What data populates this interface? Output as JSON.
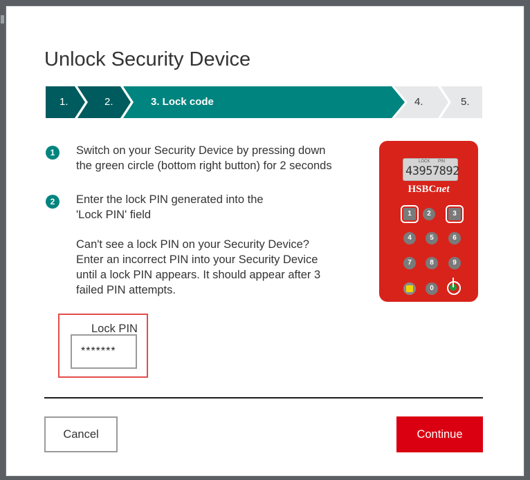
{
  "dialog": {
    "title": "Unlock Security Device"
  },
  "stepper": {
    "steps": [
      {
        "label": "1.",
        "state": "done"
      },
      {
        "label": "2.",
        "state": "done"
      },
      {
        "label": "3. Lock code",
        "state": "current"
      },
      {
        "label": "4.",
        "state": "todo"
      },
      {
        "label": "5.",
        "state": "todo"
      }
    ],
    "colors": {
      "done": "#005b5e",
      "current": "#00847f",
      "todo": "#e6e8ea"
    }
  },
  "instructions": [
    {
      "number": "1",
      "text": "Switch on your Security Device by pressing down\nthe green circle (bottom right button) for 2 seconds"
    },
    {
      "number": "2",
      "text": "Enter the lock PIN generated into the\n'Lock PIN' field"
    },
    {
      "number": "",
      "text": "Can't see a lock PIN on your Security Device?\nEnter an incorrect PIN into your Security Device\nuntil a lock PIN appears. It should appear after 3\nfailed PIN attempts."
    }
  ],
  "device": {
    "lcd_labels": [
      "LOCK",
      "PIN"
    ],
    "display": "43957892",
    "brand_prefix": "HSBC",
    "brand_suffix": "net",
    "keys": [
      "1",
      "2",
      "3",
      "4",
      "5",
      "6",
      "7",
      "8",
      "9",
      "",
      "0",
      ""
    ],
    "color": "#d8231b"
  },
  "lock_pin": {
    "label": "Lock PIN",
    "value": "*******"
  },
  "buttons": {
    "cancel": "Cancel",
    "continue": "Continue"
  },
  "colors": {
    "accent": "#00847f",
    "primary_button": "#db0011",
    "highlight_border": "#e34b4b"
  }
}
